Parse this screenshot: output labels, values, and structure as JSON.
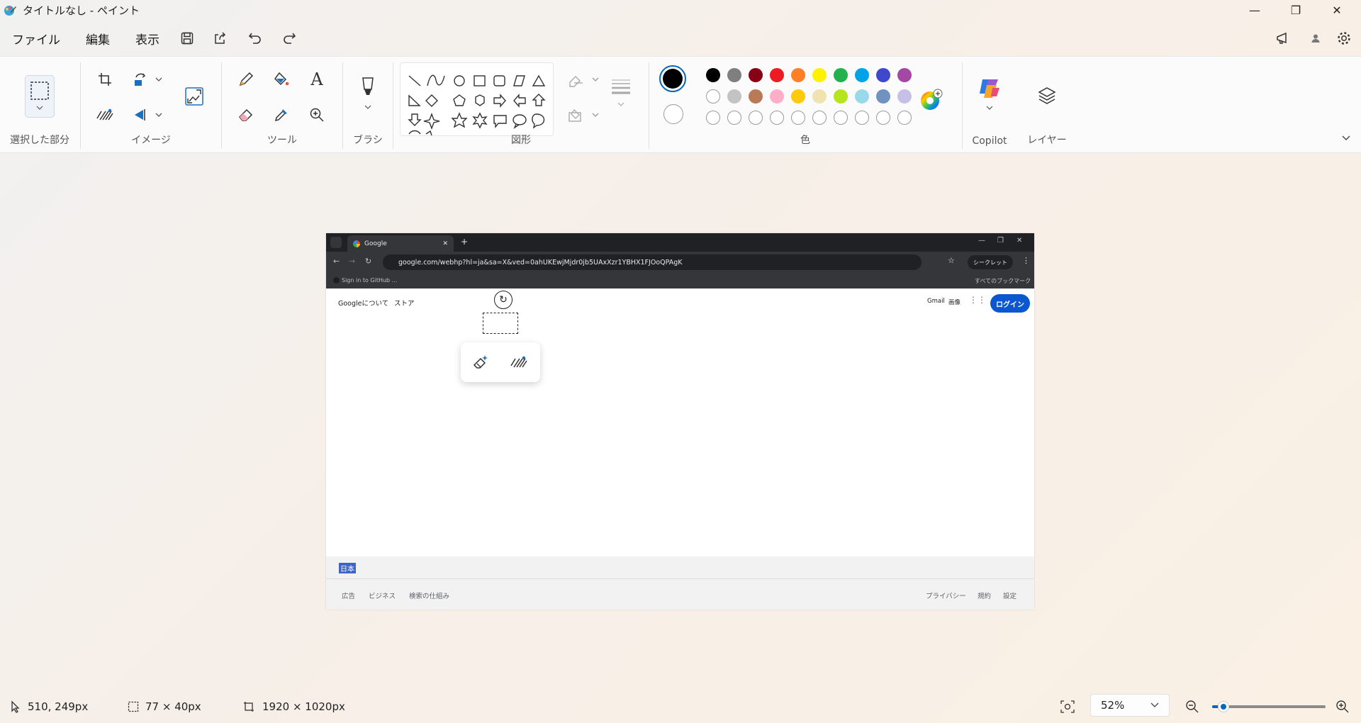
{
  "window": {
    "title": "タイトルなし - ペイント",
    "minimize": "—",
    "restore": "❐",
    "close": "✕"
  },
  "menu": {
    "file": "ファイル",
    "edit": "編集",
    "view": "表示"
  },
  "ribbon": {
    "selection_label": "選択した部分",
    "image_label": "イメージ",
    "tools_label": "ツール",
    "brushes_label": "ブラシ",
    "shapes_label": "図形",
    "colors_label": "色",
    "copilot_label": "Copilot",
    "layers_label": "レイヤー",
    "text_tool": "A"
  },
  "colors": {
    "primary": "#000000",
    "secondary": "#ffffff",
    "row1": [
      "#000000",
      "#7f7f7f",
      "#880015",
      "#ed1c24",
      "#ff7f27",
      "#fff200",
      "#22b14c",
      "#00a2e8",
      "#3f48cc",
      "#a349a4"
    ],
    "row2": [
      "#ffffff",
      "#c3c3c3",
      "#b97a57",
      "#ffaec9",
      "#ffc90e",
      "#efe4b0",
      "#b5e61d",
      "#99d9ea",
      "#7092be",
      "#c8bfe7"
    ]
  },
  "canvas": {
    "tab_title": "Google",
    "url": "google.com/webhp?hl=ja&sa=X&ved=0ahUKEwjMjdr0jb5UAxXzr1YBHX1FJOoQPAgK",
    "incognito": "シークレット",
    "bookmark_left": "Sign in to GitHub ...",
    "bookmark_right": "すべてのブックマーク",
    "about": "Googleについて",
    "store": "ストア",
    "gmail": "Gmail",
    "images": "画像",
    "login": "ログイン",
    "country": "日本",
    "ads": "広告",
    "business": "ビジネス",
    "how_search": "検索の仕組み",
    "privacy": "プライバシー",
    "terms": "規約",
    "settings": "設定"
  },
  "status": {
    "cursor": "510, 249px",
    "selection": "77 × 40px",
    "canvas_size": "1920 × 1020px",
    "zoom": "52%",
    "zoom_level": 0.1
  }
}
